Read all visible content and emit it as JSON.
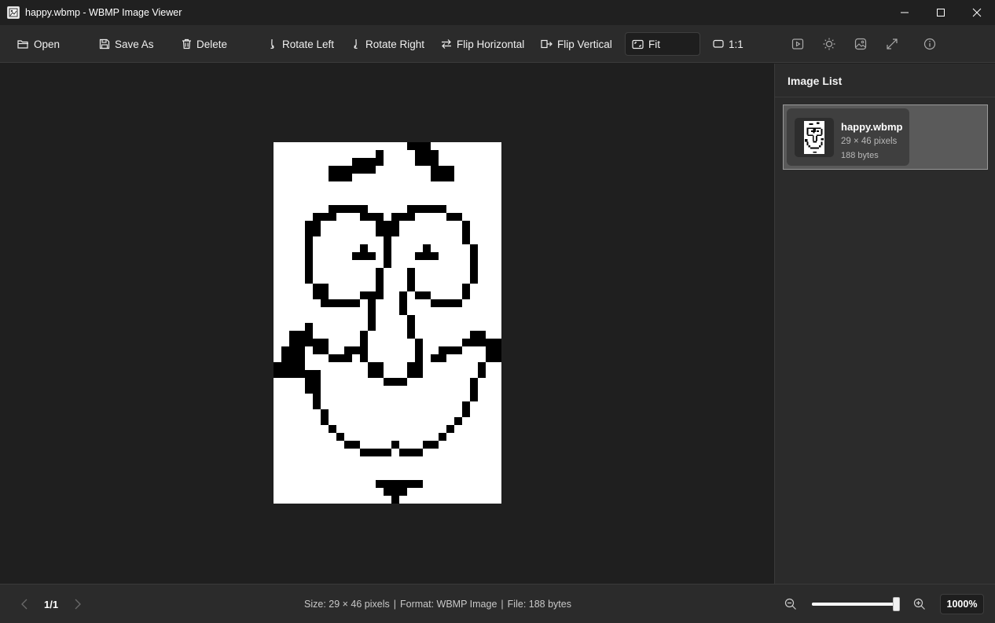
{
  "window": {
    "title": "happy.wbmp - WBMP Image Viewer"
  },
  "toolbar": {
    "open": "Open",
    "save_as": "Save As",
    "delete": "Delete",
    "rotate_left": "Rotate Left",
    "rotate_right": "Rotate Right",
    "flip_horizontal": "Flip Horizontal",
    "flip_vertical": "Flip Vertical",
    "fit": "Fit",
    "actual_size": "1:1",
    "icons": [
      "slideshow-icon",
      "brightness-icon",
      "image-adjust-icon",
      "fullscreen-icon",
      "info-icon"
    ],
    "active_mode": "Fit"
  },
  "sidebar": {
    "title": "Image List",
    "items": [
      {
        "name": "happy.wbmp",
        "dimensions": "29 × 46 pixels",
        "size": "188 bytes",
        "selected": true
      }
    ]
  },
  "statusbar": {
    "page": "1/1",
    "size_info": "Size: 29 × 46 pixels",
    "format_info": "Format: WBMP Image",
    "file_info": "File: 188 bytes",
    "separator": "|",
    "zoom": "1000%",
    "zoom_slider_fraction": 1.0
  },
  "colors": {
    "background": "#1f1f1f",
    "panel": "#2b2b2b",
    "selection": "#5a5a5a",
    "image_white": "#ffffff",
    "image_black": "#000000"
  }
}
